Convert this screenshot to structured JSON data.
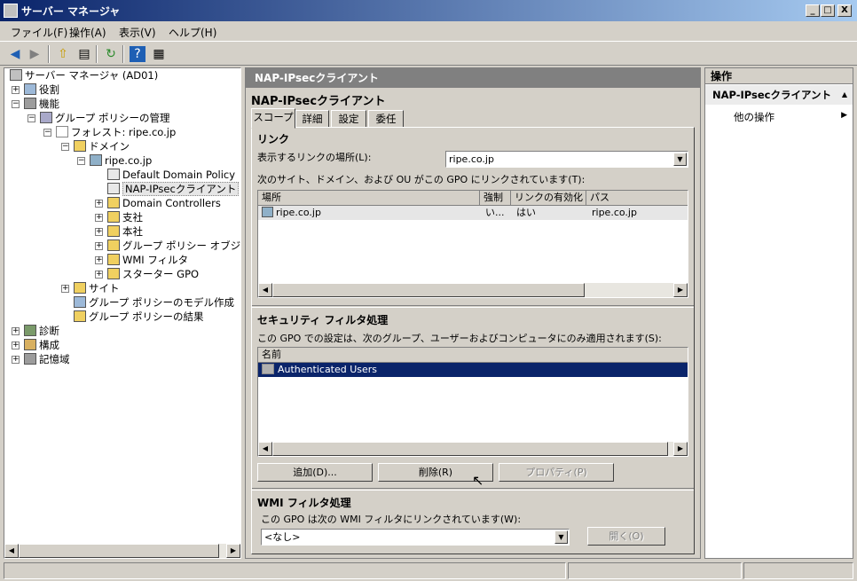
{
  "window": {
    "title": "サーバー マネージャ",
    "min": "_",
    "max": "□",
    "close": "X"
  },
  "menu": [
    "ファイル(F)",
    "操作(A)",
    "表示(V)",
    "ヘルプ(H)"
  ],
  "tree": {
    "items": [
      {
        "label": "サーバー マネージャ (AD01)"
      },
      {
        "label": "役割"
      },
      {
        "label": "機能"
      },
      {
        "label": "グループ ポリシーの管理"
      },
      {
        "label": "フォレスト: ripe.co.jp"
      },
      {
        "label": "ドメイン"
      },
      {
        "label": "ripe.co.jp"
      },
      {
        "label": "Default Domain Policy"
      },
      {
        "label": "NAP-IPsecクライアント"
      },
      {
        "label": "Domain Controllers"
      },
      {
        "label": "支社"
      },
      {
        "label": "本社"
      },
      {
        "label": "グループ ポリシー オブジェク"
      },
      {
        "label": "WMI フィルタ"
      },
      {
        "label": "スターター GPO"
      },
      {
        "label": "サイト"
      },
      {
        "label": "グループ ポリシーのモデル作成"
      },
      {
        "label": "グループ ポリシーの結果"
      },
      {
        "label": "診断"
      },
      {
        "label": "構成"
      },
      {
        "label": "記憶域"
      }
    ]
  },
  "center": {
    "header": "NAP-IPsecクライアント",
    "title": "NAP-IPsecクライアント",
    "tabs": [
      "スコープ",
      "詳細",
      "設定",
      "委任"
    ],
    "links": {
      "title": "リンク",
      "location_label": "表示するリンクの場所(L):",
      "location_value": "ripe.co.jp",
      "desc": "次のサイト、ドメイン、および OU がこの GPO にリンクされています(T):",
      "columns": [
        "場所",
        "強制",
        "リンクの有効化",
        "パス"
      ],
      "rows": [
        {
          "location": "ripe.co.jp",
          "enforced": "い...",
          "enabled": "はい",
          "path": "ripe.co.jp"
        }
      ]
    },
    "security": {
      "title": "セキュリティ フィルタ処理",
      "desc": "この GPO での設定は、次のグループ、ユーザーおよびコンピュータにのみ適用されます(S):",
      "column": "名前",
      "rows": [
        "Authenticated Users"
      ],
      "add": "追加(D)...",
      "remove": "削除(R)",
      "properties": "プロパティ(P)"
    },
    "wmi": {
      "title": "WMI フィルタ処理",
      "desc": "この GPO は次の WMI フィルタにリンクされています(W):",
      "value": "<なし>",
      "open": "開く(O)"
    }
  },
  "actions": {
    "header": "操作",
    "section": "NAP-IPsecクライアント",
    "items": [
      "他の操作"
    ]
  },
  "colors": {
    "title_start": "#0a246a",
    "title_end": "#a6caf0",
    "selection": "#0a246a"
  }
}
